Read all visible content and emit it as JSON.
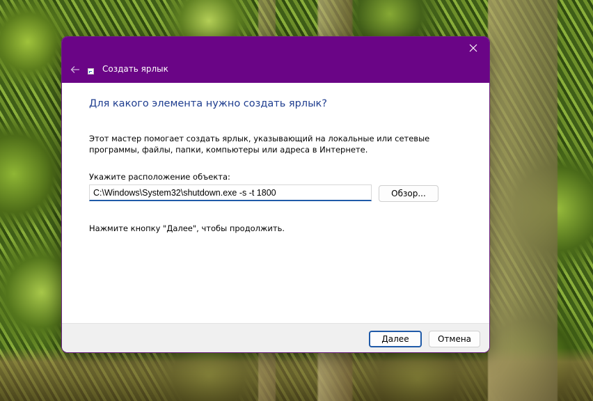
{
  "window": {
    "title": "Создать ярлык",
    "back_icon": "arrow-left-icon",
    "close_icon": "close-icon",
    "titlebar_color": "#6a0586"
  },
  "main": {
    "heading": "Для какого элемента нужно создать ярлык?",
    "description": "Этот мастер помогает создать ярлык, указывающий на локальные или сетевые программы, файлы, папки, компьютеры или адреса в Интернете.",
    "location_label": "Укажите расположение объекта:",
    "location_value": "C:\\Windows\\System32\\shutdown.exe -s -t 1800",
    "browse_label": "Обзор...",
    "hint": "Нажмите кнопку \"Далее\", чтобы продолжить."
  },
  "footer": {
    "next_label": "Далее",
    "cancel_label": "Отмена"
  }
}
